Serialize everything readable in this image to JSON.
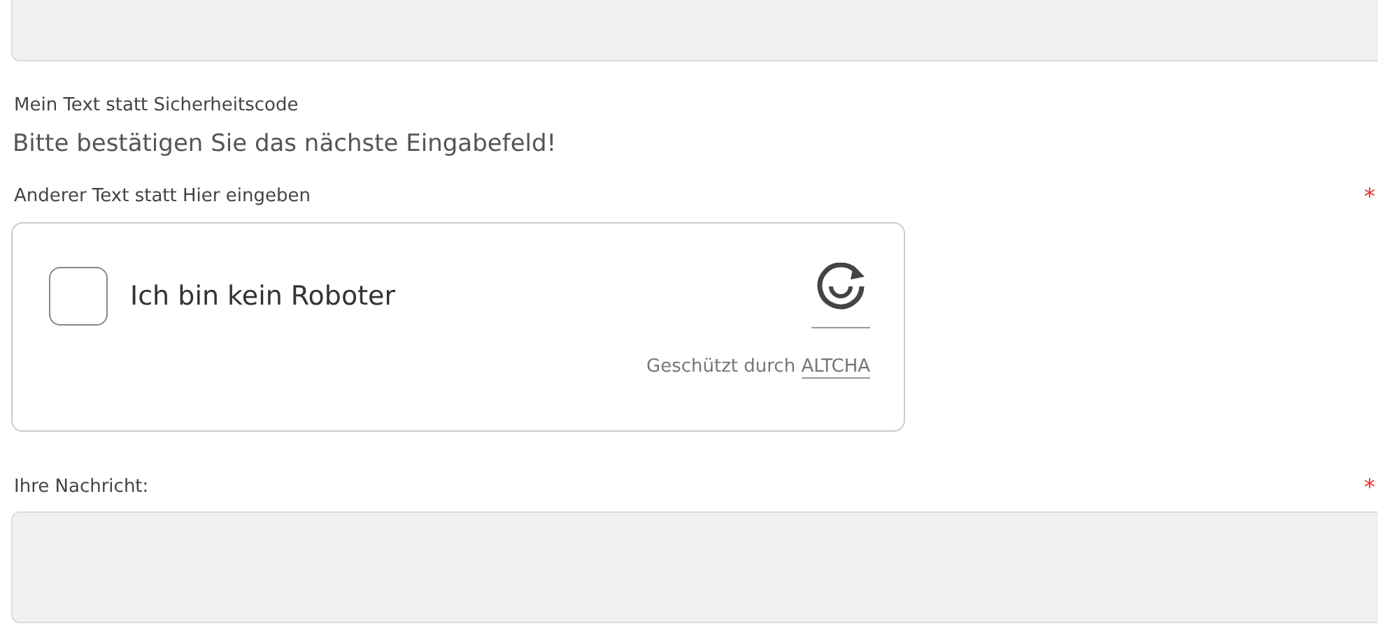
{
  "captcha_section": {
    "label": "Mein Text statt Sicherheitscode",
    "instruction": "Bitte bestätigen Sie das nächste Eingabefeld!"
  },
  "captcha_field": {
    "label": "Anderer Text statt Hier eingeben",
    "required_mark": "*",
    "widget": {
      "checkbox_label": "Ich bin kein Roboter",
      "checked": false,
      "footer_text": "Geschützt durch",
      "footer_link": "ALTCHA"
    }
  },
  "message_field": {
    "label": "Ihre Nachricht:",
    "required_mark": "*"
  }
}
